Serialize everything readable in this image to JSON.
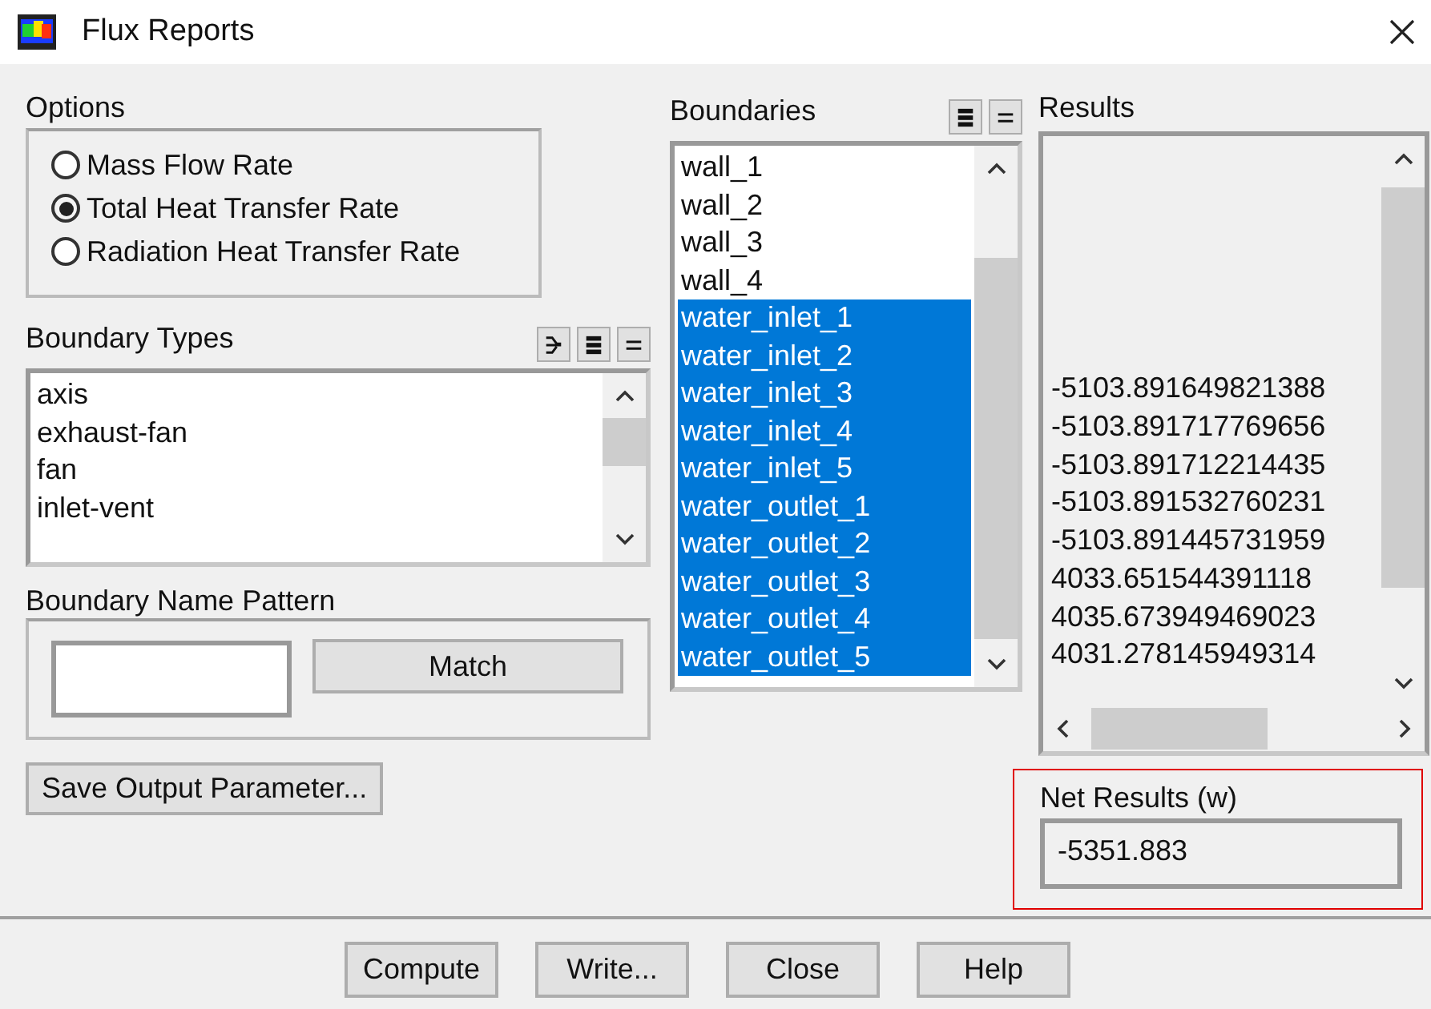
{
  "window": {
    "title": "Flux Reports"
  },
  "options": {
    "label": "Options",
    "items": [
      {
        "label": "Mass Flow Rate",
        "selected": false
      },
      {
        "label": "Total Heat Transfer Rate",
        "selected": true
      },
      {
        "label": "Radiation Heat Transfer Rate",
        "selected": false
      }
    ]
  },
  "boundary_types": {
    "label": "Boundary Types",
    "items": [
      "axis",
      "exhaust-fan",
      "fan",
      "inlet-vent"
    ]
  },
  "boundary_name_pattern": {
    "label": "Boundary Name Pattern",
    "match_button": "Match"
  },
  "save_button": "Save Output Parameter...",
  "boundaries": {
    "label": "Boundaries",
    "items": [
      {
        "label": "wall_1",
        "selected": false
      },
      {
        "label": "wall_2",
        "selected": false
      },
      {
        "label": "wall_3",
        "selected": false
      },
      {
        "label": "wall_4",
        "selected": false
      },
      {
        "label": "water_inlet_1",
        "selected": true
      },
      {
        "label": "water_inlet_2",
        "selected": true
      },
      {
        "label": "water_inlet_3",
        "selected": true
      },
      {
        "label": "water_inlet_4",
        "selected": true
      },
      {
        "label": "water_inlet_5",
        "selected": true
      },
      {
        "label": "water_outlet_1",
        "selected": true
      },
      {
        "label": "water_outlet_2",
        "selected": true
      },
      {
        "label": "water_outlet_3",
        "selected": true
      },
      {
        "label": "water_outlet_4",
        "selected": true
      },
      {
        "label": "water_outlet_5",
        "selected": true
      }
    ]
  },
  "results": {
    "label": "Results",
    "values": [
      "-5103.891649821388",
      "-5103.891717769656",
      "-5103.891712214435",
      "-5103.891532760231",
      "-5103.891445731959",
      "4033.651544391118",
      "4035.673949469023",
      "4031.278145949314"
    ]
  },
  "net_results": {
    "label": "Net Results (w)",
    "value": "-5351.883"
  },
  "buttons": [
    "Compute",
    "Write...",
    "Close",
    "Help"
  ]
}
